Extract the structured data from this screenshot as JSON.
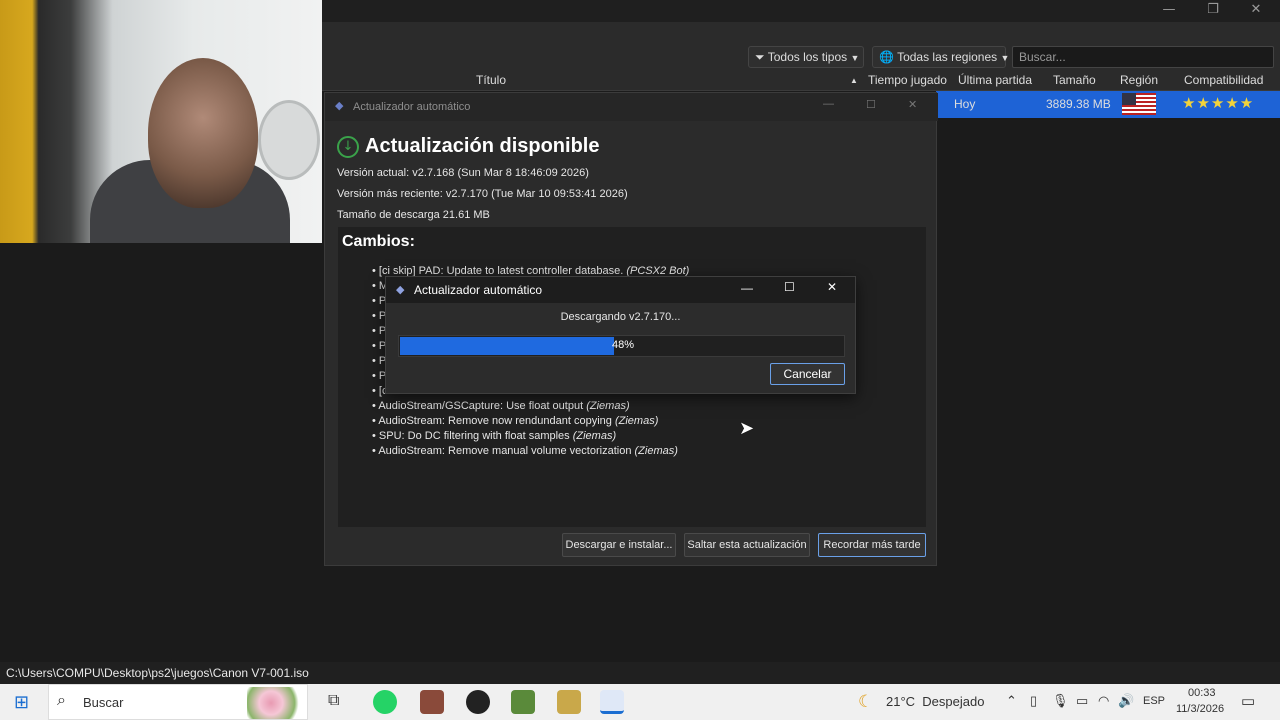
{
  "app": {
    "search_placeholder": "Buscar...",
    "filter_types": "Todos los tipos",
    "filter_regions": "Todas las regiones",
    "columns": [
      "Título",
      "Tiempo jugado",
      "Última partida",
      "Tamaño",
      "Región",
      "Compatibilidad"
    ],
    "row": {
      "last_played": "Hoy",
      "size": "3889.38 MB",
      "compatibility_stars": 5
    },
    "status_path": "C:\\Users\\COMPU\\Desktop\\ps2\\juegos\\Canon V7-001.iso"
  },
  "updater": {
    "window_title": "Actualizador automático",
    "heading": "Actualización disponible",
    "current_version": "Versión actual: v2.7.168 (Sun Mar 8 18:46:09 2026)",
    "latest_version": "Versión más reciente: v2.7.170 (Tue Mar 10 09:53:41 2026)",
    "download_size": "Tamaño de descarga 21.61 MB",
    "changes_title": "Cambios:",
    "changes": [
      {
        "text": "[ci skip] PAD: Update to latest controller database.",
        "author": "(PCSX2 Bot)"
      },
      {
        "text": "M",
        "author": ""
      },
      {
        "text": "P",
        "author": ""
      },
      {
        "text": "P",
        "author": ""
      },
      {
        "text": "P",
        "author": ""
      },
      {
        "text": "P",
        "author": ""
      },
      {
        "text": "P",
        "author": ""
      },
      {
        "text": "P",
        "author": ""
      },
      {
        "text": "[c",
        "author": ""
      },
      {
        "text": "AudioStream/GSCapture: Use float output",
        "author": "(Ziemas)"
      },
      {
        "text": "AudioStream: Remove now rendundant copying",
        "author": "(Ziemas)"
      },
      {
        "text": "SPU: Do DC filtering with float samples",
        "author": "(Ziemas)"
      },
      {
        "text": "AudioStream: Remove manual volume vectorization",
        "author": "(Ziemas)"
      }
    ],
    "btn_download": "Descargar e instalar...",
    "btn_skip": "Saltar esta actualización",
    "btn_later": "Recordar más tarde"
  },
  "progress": {
    "window_title": "Actualizador automático",
    "message": "Descargando v2.7.170...",
    "percent": 48,
    "percent_label": "48%",
    "cancel_label": "Cancelar"
  },
  "taskbar": {
    "search_label": "Buscar",
    "weather": "21°C  Despejado",
    "lang": "ESP",
    "time": "00:33",
    "date": "11/3/2026"
  },
  "colors": {
    "accent": "#1f6ae0",
    "row_selected": "#1e63d6",
    "stars": "#f2d33b",
    "check_green": "#3aa24a"
  }
}
